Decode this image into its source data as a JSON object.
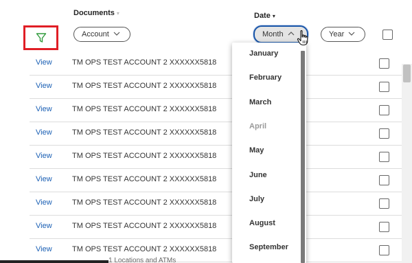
{
  "header": {
    "documents_label": "Documents",
    "date_label": "Date",
    "documents_caret": "▾",
    "date_caret": "▾"
  },
  "filters": {
    "account_label": "Account",
    "month_label": "Month",
    "year_label": "Year"
  },
  "rows": [
    {
      "view": "View",
      "account": "TM OPS TEST ACCOUNT 2 XXXXXX5818"
    },
    {
      "view": "View",
      "account": "TM OPS TEST ACCOUNT 2 XXXXXX5818"
    },
    {
      "view": "View",
      "account": "TM OPS TEST ACCOUNT 2 XXXXXX5818"
    },
    {
      "view": "View",
      "account": "TM OPS TEST ACCOUNT 2 XXXXXX5818"
    },
    {
      "view": "View",
      "account": "TM OPS TEST ACCOUNT 2 XXXXXX5818"
    },
    {
      "view": "View",
      "account": "TM OPS TEST ACCOUNT 2 XXXXXX5818"
    },
    {
      "view": "View",
      "account": "TM OPS TEST ACCOUNT 2 XXXXXX5818"
    },
    {
      "view": "View",
      "account": "TM OPS TEST ACCOUNT 2 XXXXXX5818"
    },
    {
      "view": "View",
      "account": "TM OPS TEST ACCOUNT 2 XXXXXX5818"
    }
  ],
  "month_dropdown": {
    "options": [
      {
        "label": "January",
        "disabled": false
      },
      {
        "label": "February",
        "disabled": false
      },
      {
        "label": "March",
        "disabled": false
      },
      {
        "label": "April",
        "disabled": true
      },
      {
        "label": "May",
        "disabled": false
      },
      {
        "label": "June",
        "disabled": false
      },
      {
        "label": "July",
        "disabled": false
      },
      {
        "label": "August",
        "disabled": false
      },
      {
        "label": "September",
        "disabled": false
      }
    ]
  },
  "footer": {
    "partial_text": "1  Locations and ATMs"
  },
  "colors": {
    "filter_highlight": "#e01e25",
    "filter_icon": "#2e9a3a",
    "link": "#1a5fb4",
    "active_outline": "#1a56a8"
  },
  "icons": {
    "filter": "funnel-icon",
    "cursor": "hand-pointer-icon"
  }
}
